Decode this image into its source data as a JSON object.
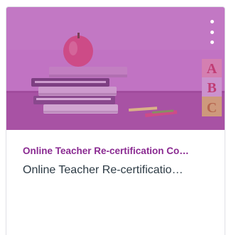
{
  "card": {
    "subtitle": "Online Teacher Re-certification Co…",
    "title": "Online Teacher Re-certificatio…",
    "overlay_color": "#b04fb3",
    "subtitle_color": "#8a2a91",
    "hero_image": "books-apple-blocks-image",
    "menu_icon": "vertical-ellipsis-icon",
    "block_letters": [
      "A",
      "B",
      "C"
    ]
  }
}
